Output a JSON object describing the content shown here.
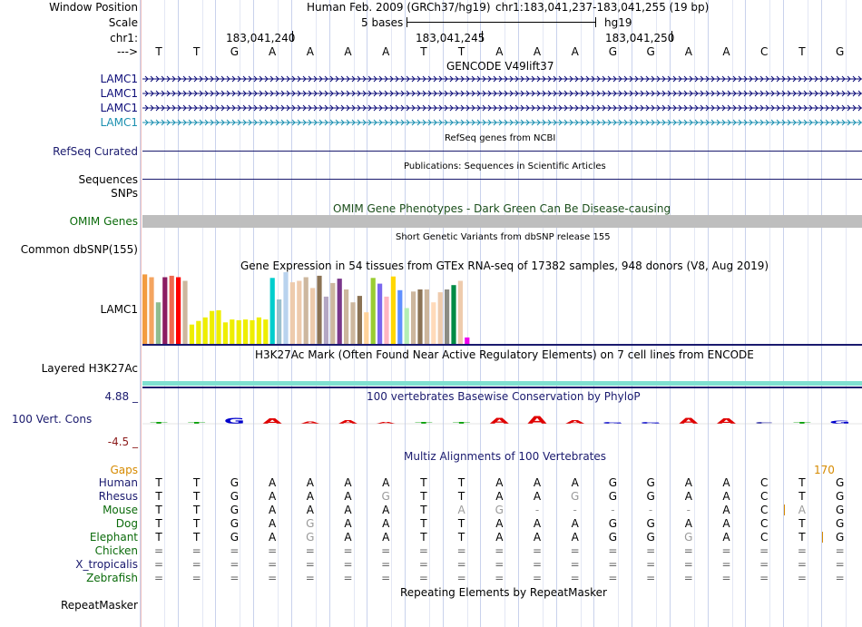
{
  "header": {
    "window_position_label": "Window Position",
    "scale_label": "Scale",
    "chr_label": "chr1:",
    "arrow_label": "--->",
    "assembly": "Human Feb. 2009 (GRCh37/hg19)",
    "position": "chr1:183,041,237-183,041,255 (19 bp)",
    "scale_bases": "5 bases",
    "db": "hg19",
    "coords": [
      "183,041,240",
      "183,041,245",
      "183,041,250"
    ]
  },
  "sequence": [
    "T",
    "T",
    "G",
    "A",
    "A",
    "A",
    "A",
    "T",
    "T",
    "A",
    "A",
    "A",
    "G",
    "G",
    "A",
    "A",
    "C",
    "T",
    "G"
  ],
  "tracks": {
    "gencode_title": "GENCODE V49lift37",
    "gencode_labels": [
      "LAMC1",
      "LAMC1",
      "LAMC1",
      "LAMC1"
    ],
    "refseq_label": "RefSeq Curated",
    "refseq_title": "RefSeq genes from NCBI",
    "sequences_label": "Sequences",
    "sequences_title": "Publications: Sequences in Scientific Articles",
    "snps_label": "SNPs",
    "omim_title": "OMIM Gene Phenotypes - Dark Green Can Be Disease-causing",
    "omim_label": "OMIM Genes",
    "dbsnp_title": "Short Genetic Variants from dbSNP release 155",
    "dbsnp_label": "Common dbSNP(155)",
    "gtex_title": "Gene Expression in 54 tissues from GTEx RNA-seq of 17382 samples, 948 donors (V8, Aug 2019)",
    "gtex_label": "LAMC1",
    "h3k27_title": "H3K27Ac Mark (Often Found Near Active Regulatory Elements) on 7 cell lines from ENCODE",
    "h3k27_label": "Layered H3K27Ac",
    "phylop_title": "100 vertebrates Basewise Conservation by PhyloP",
    "phylop_label": "100 Vert. Cons",
    "phylop_max": "4.88 _",
    "phylop_min": "-4.5 _",
    "multiz_title": "Multiz Alignments of 100 Vertebrates",
    "gaps_label": "Gaps",
    "gaps_value": "170",
    "repeat_title": "Repeating Elements by RepeatMasker",
    "repeat_label": "RepeatMasker"
  },
  "gtex_expression": [
    {
      "v": 0.97,
      "c": "#f39c41"
    },
    {
      "v": 0.93,
      "c": "#f4a460"
    },
    {
      "v": 0.58,
      "c": "#8fbc8f"
    },
    {
      "v": 0.93,
      "c": "#8b1c62"
    },
    {
      "v": 0.95,
      "c": "#ee6a50"
    },
    {
      "v": 0.93,
      "c": "#ff0000"
    },
    {
      "v": 0.88,
      "c": "#cdb79e"
    },
    {
      "v": 0.27,
      "c": "#eeee00"
    },
    {
      "v": 0.32,
      "c": "#eeee00"
    },
    {
      "v": 0.37,
      "c": "#eeee00"
    },
    {
      "v": 0.46,
      "c": "#eeee00"
    },
    {
      "v": 0.47,
      "c": "#eeee00"
    },
    {
      "v": 0.3,
      "c": "#eeee00"
    },
    {
      "v": 0.34,
      "c": "#eeee00"
    },
    {
      "v": 0.33,
      "c": "#eeee00"
    },
    {
      "v": 0.34,
      "c": "#eeee00"
    },
    {
      "v": 0.33,
      "c": "#eeee00"
    },
    {
      "v": 0.37,
      "c": "#eeee00"
    },
    {
      "v": 0.34,
      "c": "#eeee00"
    },
    {
      "v": 0.92,
      "c": "#00cdcd"
    },
    {
      "v": 0.62,
      "c": "#9ac0cd"
    },
    {
      "v": 1.0,
      "c": "#b9d3ee"
    },
    {
      "v": 0.86,
      "c": "#eecbad"
    },
    {
      "v": 0.88,
      "c": "#eecbad"
    },
    {
      "v": 0.93,
      "c": "#cdb79e"
    },
    {
      "v": 0.78,
      "c": "#eecbad"
    },
    {
      "v": 0.95,
      "c": "#8b7355"
    },
    {
      "v": 0.66,
      "c": "#b4a7c4"
    },
    {
      "v": 0.85,
      "c": "#cdb79e"
    },
    {
      "v": 0.91,
      "c": "#7a378b"
    },
    {
      "v": 0.76,
      "c": "#cdb79e"
    },
    {
      "v": 0.58,
      "c": "#cdb79e"
    },
    {
      "v": 0.67,
      "c": "#8b7355"
    },
    {
      "v": 0.44,
      "c": "#ffd39b"
    },
    {
      "v": 0.92,
      "c": "#9acd32"
    },
    {
      "v": 0.84,
      "c": "#7a67ee"
    },
    {
      "v": 0.66,
      "c": "#ffb6c1"
    },
    {
      "v": 0.94,
      "c": "#ffd700"
    },
    {
      "v": 0.75,
      "c": "#5f8fff"
    },
    {
      "v": 0.5,
      "c": "#b4eeb4"
    },
    {
      "v": 0.73,
      "c": "#cdb79e"
    },
    {
      "v": 0.76,
      "c": "#8b7355"
    },
    {
      "v": 0.76,
      "c": "#cdb79e"
    },
    {
      "v": 0.58,
      "c": "#ffdab9"
    },
    {
      "v": 0.72,
      "c": "#eecbad"
    },
    {
      "v": 0.76,
      "c": "#8b8b83"
    },
    {
      "v": 0.82,
      "c": "#008b45"
    },
    {
      "v": 0.88,
      "c": "#eecbad"
    },
    {
      "v": 0.09,
      "c": "#ee00ee"
    }
  ],
  "alignments": [
    {
      "species": "Human",
      "color": "#1a1a6e",
      "bases": [
        "T",
        "T",
        "G",
        "A",
        "A",
        "A",
        "A",
        "T",
        "T",
        "A",
        "A",
        "A",
        "G",
        "G",
        "A",
        "A",
        "C",
        "T",
        "G"
      ]
    },
    {
      "species": "Rhesus",
      "color": "#1a1a6e",
      "bases": [
        "T",
        "T",
        "G",
        "A",
        "A",
        "A",
        "G",
        "T",
        "T",
        "A",
        "A",
        "G",
        "G",
        "G",
        "A",
        "A",
        "C",
        "T",
        "G"
      ]
    },
    {
      "species": "Mouse",
      "color": "#0b6b0b",
      "bases": [
        "T",
        "T",
        "G",
        "A",
        "A",
        "A",
        "A",
        "T",
        "A",
        "G",
        "-",
        "-",
        "-",
        "-",
        "-",
        "A",
        "C",
        "A",
        "G"
      ]
    },
    {
      "species": "Dog",
      "color": "#0b6b0b",
      "bases": [
        "T",
        "T",
        "G",
        "A",
        "G",
        "A",
        "A",
        "T",
        "T",
        "A",
        "A",
        "A",
        "G",
        "G",
        "A",
        "A",
        "C",
        "T",
        "G"
      ]
    },
    {
      "species": "Elephant",
      "color": "#0b6b0b",
      "bases": [
        "T",
        "T",
        "G",
        "A",
        "G",
        "A",
        "A",
        "T",
        "T",
        "A",
        "A",
        "A",
        "G",
        "G",
        "G",
        "A",
        "C",
        "T",
        "G"
      ]
    },
    {
      "species": "Chicken",
      "color": "#0b6b0b",
      "bases": [
        "=",
        "=",
        "=",
        "=",
        "=",
        "=",
        "=",
        "=",
        "=",
        "=",
        "=",
        "=",
        "=",
        "=",
        "=",
        "=",
        "=",
        "=",
        "="
      ]
    },
    {
      "species": "X_tropicalis",
      "color": "#1a1a6e",
      "bases": [
        "=",
        "=",
        "=",
        "=",
        "=",
        "=",
        "=",
        "=",
        "=",
        "=",
        "=",
        "=",
        "=",
        "=",
        "=",
        "=",
        "=",
        "=",
        "="
      ]
    },
    {
      "species": "Zebrafish",
      "color": "#0b6b0b",
      "bases": [
        "=",
        "=",
        "=",
        "=",
        "=",
        "=",
        "=",
        "=",
        "=",
        "=",
        "=",
        "=",
        "=",
        "=",
        "=",
        "=",
        "=",
        "=",
        "="
      ]
    }
  ],
  "colors": {
    "gencode": "#0c0c78",
    "gencode_light": "#1a8fb0",
    "omim_bar": "#bebebe",
    "h3k27": "#7fe0d0",
    "phylop_max": "#1a1a6e",
    "phylop_min": "#8b1a1a",
    "gaps": "#d68a00"
  }
}
